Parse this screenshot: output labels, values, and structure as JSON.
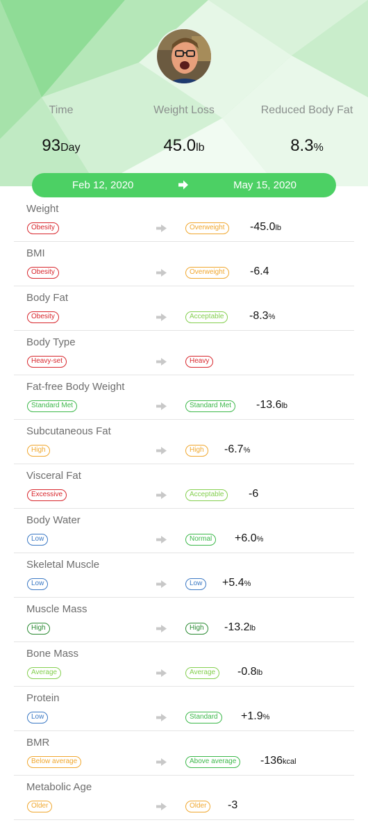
{
  "header": {
    "stats": [
      {
        "label": "Time",
        "value": "93",
        "unit": "Day"
      },
      {
        "label": "Weight Loss",
        "value": "45.0",
        "unit": "lb"
      },
      {
        "label": "Reduced Body Fat",
        "value": "8.3",
        "unit": "%"
      }
    ],
    "start_date": "Feb 12, 2020",
    "end_date": "May 15, 2020"
  },
  "colors": {
    "red": "#d8262c",
    "orange": "#f0a72e",
    "light_green": "#84cf4f",
    "green": "#3cb84a",
    "blue": "#3a78c4",
    "dark_green": "#2a8a32",
    "pill": "#4cd064"
  },
  "metrics": [
    {
      "name": "Weight",
      "from": "Obesity",
      "from_color": "red",
      "to": "Overweight",
      "to_color": "orange",
      "change": "-45.0",
      "unit": "lb"
    },
    {
      "name": "BMI",
      "from": "Obesity",
      "from_color": "red",
      "to": "Overweight",
      "to_color": "orange",
      "change": "-6.4",
      "unit": ""
    },
    {
      "name": "Body Fat",
      "from": "Obesity",
      "from_color": "red",
      "to": "Acceptable",
      "to_color": "light_green",
      "change": "-8.3",
      "unit": "%"
    },
    {
      "name": "Body Type",
      "from": "Heavy-set",
      "from_color": "red",
      "to": "Heavy",
      "to_color": "red",
      "change": "",
      "unit": ""
    },
    {
      "name": "Fat-free Body Weight",
      "from": "Standard Met",
      "from_color": "green",
      "to": "Standard Met",
      "to_color": "green",
      "change": "-13.6",
      "unit": "lb"
    },
    {
      "name": "Subcutaneous Fat",
      "from": "High",
      "from_color": "orange",
      "to": "High",
      "to_color": "orange",
      "change": "-6.7",
      "unit": "%"
    },
    {
      "name": "Visceral Fat",
      "from": "Excessive",
      "from_color": "red",
      "to": "Acceptable",
      "to_color": "light_green",
      "change": "-6",
      "unit": ""
    },
    {
      "name": "Body Water",
      "from": "Low",
      "from_color": "blue",
      "to": "Normal",
      "to_color": "green",
      "change": "+6.0",
      "unit": "%"
    },
    {
      "name": "Skeletal Muscle",
      "from": "Low",
      "from_color": "blue",
      "to": "Low",
      "to_color": "blue",
      "change": "+5.4",
      "unit": "%"
    },
    {
      "name": "Muscle Mass",
      "from": "High",
      "from_color": "dark_green",
      "to": "High",
      "to_color": "dark_green",
      "change": "-13.2",
      "unit": "lb"
    },
    {
      "name": "Bone Mass",
      "from": "Average",
      "from_color": "light_green",
      "to": "Average",
      "to_color": "light_green",
      "change": "-0.8",
      "unit": "lb"
    },
    {
      "name": "Protein",
      "from": "Low",
      "from_color": "blue",
      "to": "Standard",
      "to_color": "green",
      "change": "+1.9",
      "unit": "%"
    },
    {
      "name": "BMR",
      "from": "Below average",
      "from_color": "orange",
      "to": "Above average",
      "to_color": "green",
      "change": "-136",
      "unit": "kcal"
    },
    {
      "name": "Metabolic Age",
      "from": "Older",
      "from_color": "orange",
      "to": "Older",
      "to_color": "orange",
      "change": "-3",
      "unit": ""
    }
  ]
}
